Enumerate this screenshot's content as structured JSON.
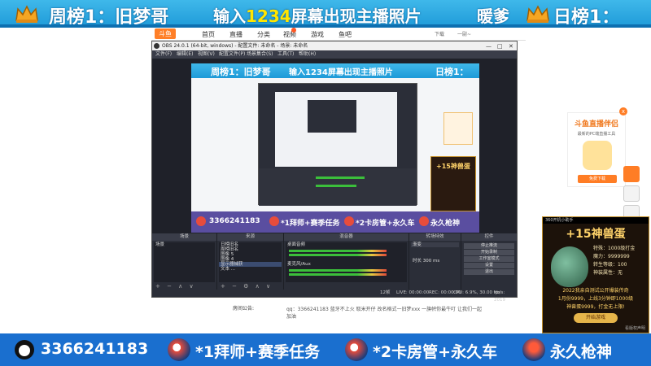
{
  "top_banner": {
    "weekly_rank": "周榜1：旧梦哥",
    "cta_prefix": "输入",
    "cta_highlight": "1234",
    "cta_suffix": "屏幕出现主播照片",
    "daily_name": "暖爹",
    "daily_rank": "日榜1：",
    "crown_color": "#f5a623"
  },
  "site_nav": {
    "logo": "斗鱼",
    "items": [
      "首页",
      "直播",
      "分类",
      "视频",
      "游戏",
      "鱼吧"
    ],
    "download": "下载",
    "user": "一尉~"
  },
  "obs": {
    "title": "OBS 24.0.1 (64-bit, windows) - 配置文件: 未命名 - 场景: 未命名",
    "menu": [
      "文件(F)",
      "编辑(E)",
      "视图(V)",
      "配置文件(P)",
      "场景集合(S)",
      "工具(T)",
      "帮助(H)"
    ],
    "preview": {
      "banner_rank": "周榜1：旧梦哥",
      "banner_cta": "输入1234屏幕出现主播照片",
      "banner_daily": "日榜1：",
      "game_title": "+15神兽蛋",
      "bottom_qq": "3366241183",
      "bottom_task1": "*1拜师+赛季任务",
      "bottom_task2": "*2卡房管+永久车",
      "bottom_task3": "永久枪神"
    },
    "docks": {
      "scenes_title": "场景",
      "scenes": [
        "场景"
      ],
      "sources_title": "来源",
      "sources": [
        "日榜旧名",
        "周榜旧名",
        "图像 5",
        "图像 4",
        "显示器捕获",
        "文本 ..."
      ],
      "mixer_title": "混音器",
      "mixer": [
        {
          "name": "桌面音频",
          "level": "0.0 dB"
        },
        {
          "name": "麦克风/Aux",
          "level": "0.0 dB"
        }
      ],
      "transition_title": "转场特效",
      "transition_value": "渐变",
      "duration_label": "时长",
      "duration_value": "300 ms",
      "controls_title": "控件",
      "controls": [
        "停止推流",
        "开始录制",
        "工作室模式",
        "设置",
        "退出"
      ]
    },
    "status": {
      "live": "LIVE: 00:00:00",
      "rec": "REC: 00:00:00",
      "cpu": "CPU: 6.9%, 30.00 fps",
      "bitrate": "kb/s: 2019",
      "dropped": "12帧"
    }
  },
  "room_notice": {
    "label": "房间公告:",
    "text": "qq：3366241183 蓝牙不上火 取米开仔 改名格式一旧梦xxx 一旗帜你最牛叮 让我们一起加油"
  },
  "ad_widget": {
    "title": "斗鱼直播伴侣",
    "subtitle": "最新的PC端直播工具",
    "button": "免费下载",
    "close": "x"
  },
  "game_ad": {
    "header": "360开机小助手",
    "title": "+15神兽蛋",
    "stats": [
      "特殊：1000级打金",
      "魔力：9999999",
      "转生等级：100",
      "神装属性：无"
    ],
    "desc": [
      "2022我亲自测试公开爆装传奇",
      "1月份9999，上线3分钟即1000级",
      "神兽蛋9999，打金无上限!"
    ],
    "cta": "开始游戏",
    "note": "看版权声明"
  },
  "bottom_banner": {
    "qq": "3366241183",
    "task1": "*1拜师+赛季任务",
    "task2": "*2卡房管+永久车",
    "task3": "永久枪神"
  }
}
